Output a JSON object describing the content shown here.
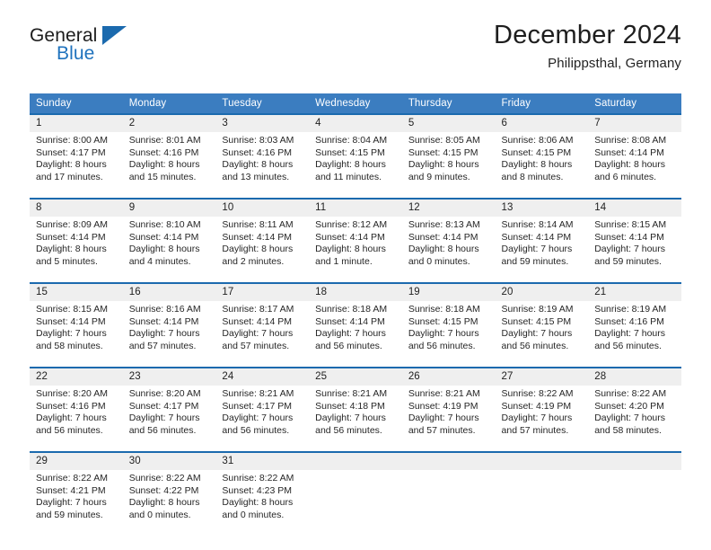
{
  "brand": {
    "name_part1": "General",
    "name_part2": "Blue",
    "accent_color": "#1b6aae"
  },
  "header": {
    "title": "December 2024",
    "subtitle": "Philippsthal, Germany"
  },
  "calendar": {
    "header_bg": "#3b7dc0",
    "daynum_bg": "#efefef",
    "separator_color": "#1b6aae",
    "weekday_headers": [
      "Sunday",
      "Monday",
      "Tuesday",
      "Wednesday",
      "Thursday",
      "Friday",
      "Saturday"
    ],
    "weeks": [
      [
        {
          "day": "1",
          "sunrise": "Sunrise: 8:00 AM",
          "sunset": "Sunset: 4:17 PM",
          "daylight_line1": "Daylight: 8 hours",
          "daylight_line2": "and 17 minutes."
        },
        {
          "day": "2",
          "sunrise": "Sunrise: 8:01 AM",
          "sunset": "Sunset: 4:16 PM",
          "daylight_line1": "Daylight: 8 hours",
          "daylight_line2": "and 15 minutes."
        },
        {
          "day": "3",
          "sunrise": "Sunrise: 8:03 AM",
          "sunset": "Sunset: 4:16 PM",
          "daylight_line1": "Daylight: 8 hours",
          "daylight_line2": "and 13 minutes."
        },
        {
          "day": "4",
          "sunrise": "Sunrise: 8:04 AM",
          "sunset": "Sunset: 4:15 PM",
          "daylight_line1": "Daylight: 8 hours",
          "daylight_line2": "and 11 minutes."
        },
        {
          "day": "5",
          "sunrise": "Sunrise: 8:05 AM",
          "sunset": "Sunset: 4:15 PM",
          "daylight_line1": "Daylight: 8 hours",
          "daylight_line2": "and 9 minutes."
        },
        {
          "day": "6",
          "sunrise": "Sunrise: 8:06 AM",
          "sunset": "Sunset: 4:15 PM",
          "daylight_line1": "Daylight: 8 hours",
          "daylight_line2": "and 8 minutes."
        },
        {
          "day": "7",
          "sunrise": "Sunrise: 8:08 AM",
          "sunset": "Sunset: 4:14 PM",
          "daylight_line1": "Daylight: 8 hours",
          "daylight_line2": "and 6 minutes."
        }
      ],
      [
        {
          "day": "8",
          "sunrise": "Sunrise: 8:09 AM",
          "sunset": "Sunset: 4:14 PM",
          "daylight_line1": "Daylight: 8 hours",
          "daylight_line2": "and 5 minutes."
        },
        {
          "day": "9",
          "sunrise": "Sunrise: 8:10 AM",
          "sunset": "Sunset: 4:14 PM",
          "daylight_line1": "Daylight: 8 hours",
          "daylight_line2": "and 4 minutes."
        },
        {
          "day": "10",
          "sunrise": "Sunrise: 8:11 AM",
          "sunset": "Sunset: 4:14 PM",
          "daylight_line1": "Daylight: 8 hours",
          "daylight_line2": "and 2 minutes."
        },
        {
          "day": "11",
          "sunrise": "Sunrise: 8:12 AM",
          "sunset": "Sunset: 4:14 PM",
          "daylight_line1": "Daylight: 8 hours",
          "daylight_line2": "and 1 minute."
        },
        {
          "day": "12",
          "sunrise": "Sunrise: 8:13 AM",
          "sunset": "Sunset: 4:14 PM",
          "daylight_line1": "Daylight: 8 hours",
          "daylight_line2": "and 0 minutes."
        },
        {
          "day": "13",
          "sunrise": "Sunrise: 8:14 AM",
          "sunset": "Sunset: 4:14 PM",
          "daylight_line1": "Daylight: 7 hours",
          "daylight_line2": "and 59 minutes."
        },
        {
          "day": "14",
          "sunrise": "Sunrise: 8:15 AM",
          "sunset": "Sunset: 4:14 PM",
          "daylight_line1": "Daylight: 7 hours",
          "daylight_line2": "and 59 minutes."
        }
      ],
      [
        {
          "day": "15",
          "sunrise": "Sunrise: 8:15 AM",
          "sunset": "Sunset: 4:14 PM",
          "daylight_line1": "Daylight: 7 hours",
          "daylight_line2": "and 58 minutes."
        },
        {
          "day": "16",
          "sunrise": "Sunrise: 8:16 AM",
          "sunset": "Sunset: 4:14 PM",
          "daylight_line1": "Daylight: 7 hours",
          "daylight_line2": "and 57 minutes."
        },
        {
          "day": "17",
          "sunrise": "Sunrise: 8:17 AM",
          "sunset": "Sunset: 4:14 PM",
          "daylight_line1": "Daylight: 7 hours",
          "daylight_line2": "and 57 minutes."
        },
        {
          "day": "18",
          "sunrise": "Sunrise: 8:18 AM",
          "sunset": "Sunset: 4:14 PM",
          "daylight_line1": "Daylight: 7 hours",
          "daylight_line2": "and 56 minutes."
        },
        {
          "day": "19",
          "sunrise": "Sunrise: 8:18 AM",
          "sunset": "Sunset: 4:15 PM",
          "daylight_line1": "Daylight: 7 hours",
          "daylight_line2": "and 56 minutes."
        },
        {
          "day": "20",
          "sunrise": "Sunrise: 8:19 AM",
          "sunset": "Sunset: 4:15 PM",
          "daylight_line1": "Daylight: 7 hours",
          "daylight_line2": "and 56 minutes."
        },
        {
          "day": "21",
          "sunrise": "Sunrise: 8:19 AM",
          "sunset": "Sunset: 4:16 PM",
          "daylight_line1": "Daylight: 7 hours",
          "daylight_line2": "and 56 minutes."
        }
      ],
      [
        {
          "day": "22",
          "sunrise": "Sunrise: 8:20 AM",
          "sunset": "Sunset: 4:16 PM",
          "daylight_line1": "Daylight: 7 hours",
          "daylight_line2": "and 56 minutes."
        },
        {
          "day": "23",
          "sunrise": "Sunrise: 8:20 AM",
          "sunset": "Sunset: 4:17 PM",
          "daylight_line1": "Daylight: 7 hours",
          "daylight_line2": "and 56 minutes."
        },
        {
          "day": "24",
          "sunrise": "Sunrise: 8:21 AM",
          "sunset": "Sunset: 4:17 PM",
          "daylight_line1": "Daylight: 7 hours",
          "daylight_line2": "and 56 minutes."
        },
        {
          "day": "25",
          "sunrise": "Sunrise: 8:21 AM",
          "sunset": "Sunset: 4:18 PM",
          "daylight_line1": "Daylight: 7 hours",
          "daylight_line2": "and 56 minutes."
        },
        {
          "day": "26",
          "sunrise": "Sunrise: 8:21 AM",
          "sunset": "Sunset: 4:19 PM",
          "daylight_line1": "Daylight: 7 hours",
          "daylight_line2": "and 57 minutes."
        },
        {
          "day": "27",
          "sunrise": "Sunrise: 8:22 AM",
          "sunset": "Sunset: 4:19 PM",
          "daylight_line1": "Daylight: 7 hours",
          "daylight_line2": "and 57 minutes."
        },
        {
          "day": "28",
          "sunrise": "Sunrise: 8:22 AM",
          "sunset": "Sunset: 4:20 PM",
          "daylight_line1": "Daylight: 7 hours",
          "daylight_line2": "and 58 minutes."
        }
      ],
      [
        {
          "day": "29",
          "sunrise": "Sunrise: 8:22 AM",
          "sunset": "Sunset: 4:21 PM",
          "daylight_line1": "Daylight: 7 hours",
          "daylight_line2": "and 59 minutes."
        },
        {
          "day": "30",
          "sunrise": "Sunrise: 8:22 AM",
          "sunset": "Sunset: 4:22 PM",
          "daylight_line1": "Daylight: 8 hours",
          "daylight_line2": "and 0 minutes."
        },
        {
          "day": "31",
          "sunrise": "Sunrise: 8:22 AM",
          "sunset": "Sunset: 4:23 PM",
          "daylight_line1": "Daylight: 8 hours",
          "daylight_line2": "and 0 minutes."
        },
        {
          "day": "",
          "sunrise": "",
          "sunset": "",
          "daylight_line1": "",
          "daylight_line2": ""
        },
        {
          "day": "",
          "sunrise": "",
          "sunset": "",
          "daylight_line1": "",
          "daylight_line2": ""
        },
        {
          "day": "",
          "sunrise": "",
          "sunset": "",
          "daylight_line1": "",
          "daylight_line2": ""
        },
        {
          "day": "",
          "sunrise": "",
          "sunset": "",
          "daylight_line1": "",
          "daylight_line2": ""
        }
      ]
    ]
  }
}
